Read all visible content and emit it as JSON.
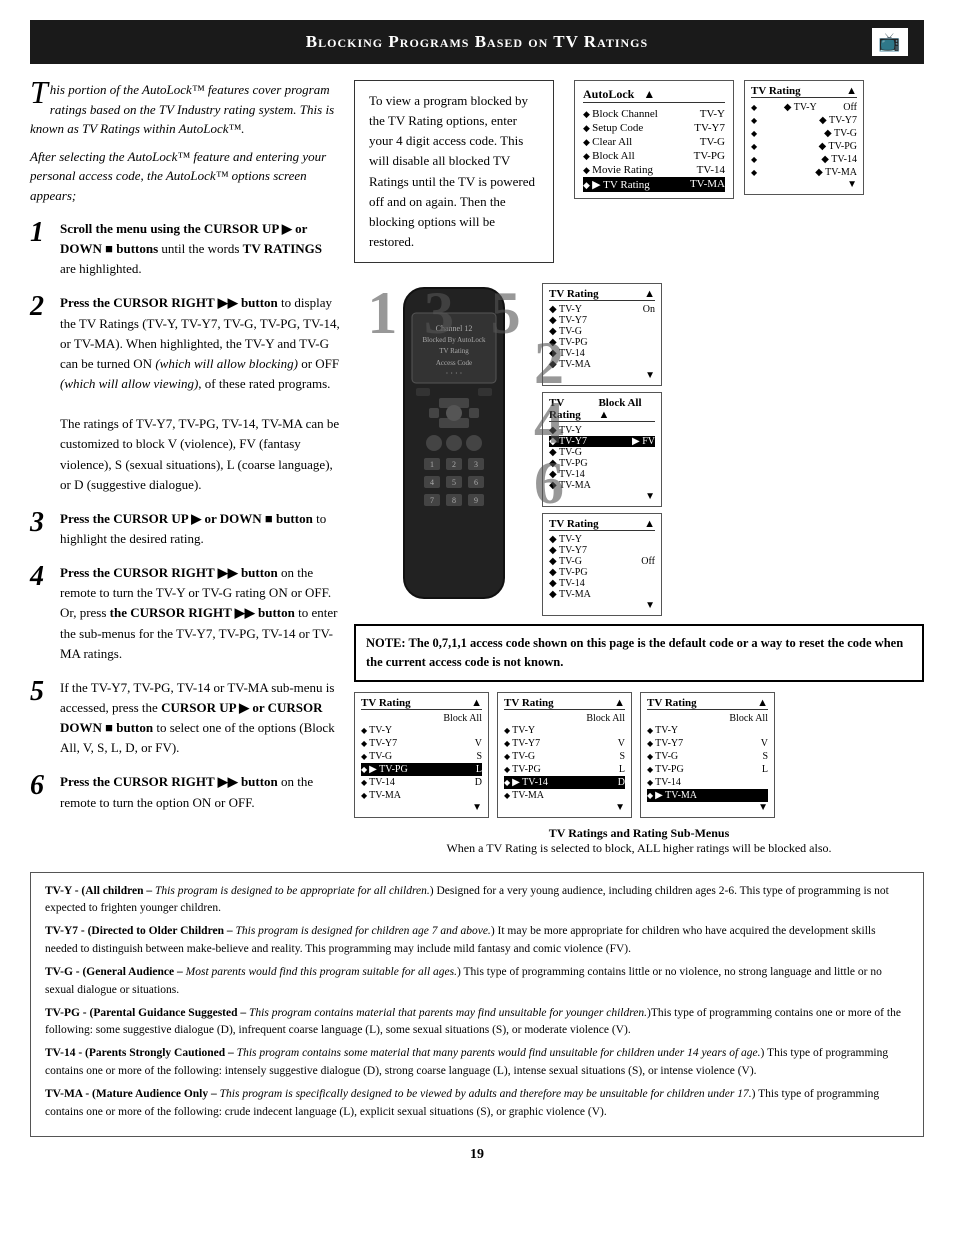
{
  "header": {
    "title": "Blocking Programs Based on TV Ratings",
    "icon": "🖥"
  },
  "intro": {
    "paragraph1": "This portion of the AutoLock™ features cover program ratings based on the TV Industry rating system. This is known as TV Ratings within AutoLock™.",
    "paragraph2": "After selecting the AutoLock™ feature and entering your personal access code, the AutoLock™ options screen appears;"
  },
  "steps": [
    {
      "number": "1",
      "bold": "Scroll the menu using the CURSOR UP ▶ or DOWN ■ buttons",
      "rest": " until the words TV RATINGS are highlighted."
    },
    {
      "number": "2",
      "bold": "Press the CURSOR RIGHT ▶▶ button",
      "rest": " to display the TV Ratings (TV-Y, TV-Y7, TV-G, TV-PG, TV-14, or TV-MA). When highlighted, the TV-Y and TV-G can be turned ON (which will allow blocking) or OFF (which will allow viewing), of these rated programs.\n\nThe ratings of TV-Y7, TV-PG, TV-14, TV-MA can be customized to block V (violence), FV (fantasy violence), S (sexual situations), L (coarse language), or D (suggestive dialogue)."
    },
    {
      "number": "3",
      "bold": "Press the CURSOR UP ▶ or DOWN ■ button",
      "rest": " to highlight the desired rating."
    },
    {
      "number": "4",
      "bold": "Press the CURSOR RIGHT ▶▶ button",
      "rest": " on the remote to turn the TV-Y or TV-G rating ON or OFF. Or, press the CURSOR RIGHT ▶▶ button to enter the sub-menus for the TV-Y7, TV-PG, TV-14 or TV-MA ratings."
    },
    {
      "number": "5",
      "bold": "If the TV-Y7, TV-PG, TV-14 or TV-MA sub-menu is accessed, press the CURSOR UP ▶ or CURSOR DOWN ■ button",
      "rest": " to select one of the options (Block All, V, S, L, D, or FV)."
    },
    {
      "number": "6",
      "bold": "Press the CURSOR RIGHT ▶▶ button",
      "rest": " on the remote to turn the option ON or OFF."
    }
  ],
  "info_box": {
    "text": "To view a program blocked by the TV Rating options, enter your 4 digit access code. This will disable all blocked TV Ratings until the TV is powered off and on again. Then the blocking options will be restored."
  },
  "autolock_menu": {
    "title": "AutoLock",
    "items": [
      {
        "label": "Block Channel",
        "value": "TV-Y"
      },
      {
        "label": "Setup Code",
        "value": "TV-Y7"
      },
      {
        "label": "Clear All",
        "value": "TV-G"
      },
      {
        "label": "Block All",
        "value": "TV-PG"
      },
      {
        "label": "Movie Rating",
        "value": "TV-14"
      },
      {
        "label": "TV Rating",
        "value": "TV-MA",
        "highlighted": true
      }
    ]
  },
  "channel_display": {
    "line1": "Channel 12",
    "line2": "Blocked By AutoLock",
    "line3": "TV Rating",
    "line4": "Access Code",
    "line5": "· · · ·"
  },
  "note": {
    "text": "NOTE: The 0,7,1,1 access code shown on this page is the default code or a way to reset the code when the current access code is not known."
  },
  "rating_panels_right": [
    {
      "title": "TV Rating",
      "up_arrow": "▲",
      "items": [
        {
          "label": "TV-Y",
          "value": "Off",
          "selected": true
        },
        {
          "label": "TV-Y7"
        },
        {
          "label": "TV-G"
        },
        {
          "label": "TV-PG"
        },
        {
          "label": "TV-14"
        },
        {
          "label": "TV-MA"
        }
      ],
      "down_arrow": "▼"
    },
    {
      "title": "TV Rating",
      "up_arrow": "▲",
      "items": [
        {
          "label": "TV-Y",
          "value": "On",
          "selected": true
        },
        {
          "label": "TV-Y7"
        },
        {
          "label": "TV-G"
        },
        {
          "label": "TV-PG"
        },
        {
          "label": "TV-14"
        },
        {
          "label": "TV-MA"
        }
      ],
      "down_arrow": "▼"
    },
    {
      "title": "TV Rating",
      "up_arrow": "▲",
      "items": [
        {
          "label": "TV-Y"
        },
        {
          "label": "TV-Y7",
          "value": "FV",
          "selected": true
        },
        {
          "label": "TV-G"
        },
        {
          "label": "TV-PG"
        },
        {
          "label": "TV-14"
        },
        {
          "label": "TV-MA"
        }
      ],
      "down_arrow": "▼",
      "block_all": true
    },
    {
      "title": "TV Rating",
      "up_arrow": "▲",
      "items": [
        {
          "label": "TV-Y"
        },
        {
          "label": "TV-Y7"
        },
        {
          "label": "TV-G",
          "value": "Off",
          "selected": true
        },
        {
          "label": "TV-PG"
        },
        {
          "label": "TV-14"
        },
        {
          "label": "TV-MA"
        }
      ],
      "down_arrow": "▼"
    }
  ],
  "bottom_panels_row1": [
    {
      "title": "TV Rating",
      "block_all_col": true,
      "items": [
        {
          "label": "TV-Y"
        },
        {
          "label": "TV-Y7",
          "value": "V"
        },
        {
          "label": "TV-G",
          "value": "S"
        },
        {
          "label": "TV-PG",
          "value": "L",
          "selected": true,
          "arrow": "▶"
        },
        {
          "label": "TV-14",
          "value": "D"
        },
        {
          "label": "TV-MA",
          "value": ""
        }
      ]
    },
    {
      "title": "TV Rating",
      "block_all_col": true,
      "items": [
        {
          "label": "TV-Y"
        },
        {
          "label": "TV-Y7",
          "value": "V"
        },
        {
          "label": "TV-G",
          "value": "S"
        },
        {
          "label": "TV-PG",
          "value": "L"
        },
        {
          "label": "TV-14",
          "value": "D",
          "selected": true,
          "arrow": "▶"
        },
        {
          "label": "TV-MA",
          "value": ""
        }
      ]
    },
    {
      "title": "TV Rating",
      "block_all_col": true,
      "items": [
        {
          "label": "TV-Y"
        },
        {
          "label": "TV-Y7",
          "value": "V"
        },
        {
          "label": "TV-G",
          "value": "S"
        },
        {
          "label": "TV-PG",
          "value": "L"
        },
        {
          "label": "TV-14",
          "value": ""
        },
        {
          "label": "TV-MA",
          "value": "",
          "selected": true,
          "arrow": "▶"
        }
      ]
    }
  ],
  "rating_caption": {
    "title": "TV Ratings and Rating Sub-Menus",
    "text": "When a TV Rating is selected to block, ALL higher ratings will be blocked also."
  },
  "footer": {
    "definitions": [
      {
        "rating": "TV-Y",
        "bold_part": "TV-Y - (All children –",
        "italic_part": "This program is designed to be appropriate for all children.",
        "rest": ") Designed for a very young audience, including children ages 2-6. This type of programming is not expected to frighten younger children."
      },
      {
        "rating": "TV-Y7",
        "bold_part": "TV-Y7 - (Directed to Older Children –",
        "italic_part": "This program is designed for children age 7 and above.",
        "rest": ") It may be more appropriate for children who have acquired the development skills needed to distinguish between make-believe and reality. This programming may include mild fantasy and comic violence (FV)."
      },
      {
        "rating": "TV-G",
        "bold_part": "TV-G - (General Audience –",
        "italic_part": "Most parents would find this program suitable for all ages.",
        "rest": ") This type of programming contains little or no violence, no strong language and little or no sexual dialogue or situations."
      },
      {
        "rating": "TV-PG",
        "bold_part": "TV-PG - (Parental Guidance Suggested –",
        "italic_part": "This program contains material that parents may find unsuitable for younger children.",
        "rest": ")This type of programming contains one or more of the following: some suggestive dialogue (D), infrequent coarse language (L), some sexual situations (S), or moderate violence (V)."
      },
      {
        "rating": "TV-14",
        "bold_part": "TV-14 - (Parents Strongly Cautioned –",
        "italic_part": "This program contains some material that many parents would find unsuitable for children under 14 years of age.",
        "rest": ") This type of programming contains one or more of the following: intensely suggestive dialogue (D), strong coarse language (L), intense sexual situations (S), or intense violence (V)."
      },
      {
        "rating": "TV-MA",
        "bold_part": "TV-MA - (Mature Audience Only –",
        "italic_part": "This program is specifically designed to be viewed by adults and therefore may be unsuitable for children under 17.",
        "rest": ") This type of programming contains one or more of the following: crude indecent language (L), explicit sexual situations (S), or graphic violence (V)."
      }
    ]
  },
  "page_number": "19"
}
